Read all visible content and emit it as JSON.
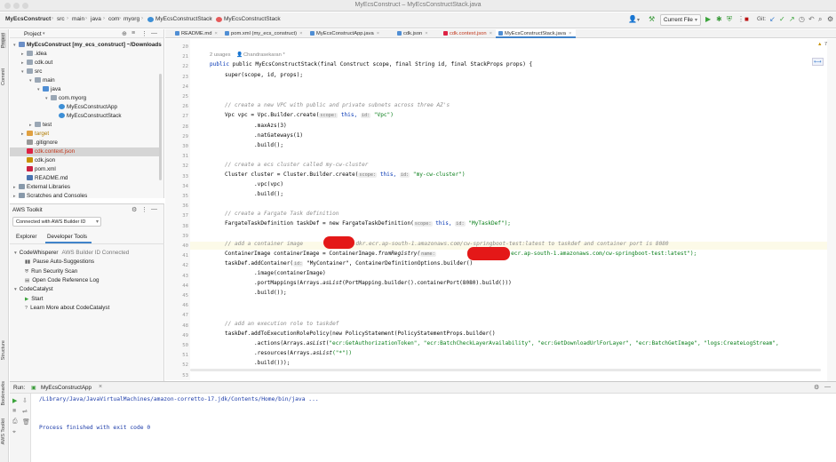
{
  "window": {
    "title": "MyEcsConstruct – MyEcsConstructStack.java"
  },
  "navbar": {
    "project": "MyEcsConstruct",
    "crumbs": [
      "src",
      "main",
      "java",
      "com",
      "myorg"
    ],
    "class_crumb": "MyEcsConstructStack",
    "class_crumb2": "MyEcsConstructStack",
    "run_config": "Current File"
  },
  "project_panel": {
    "title": "Project",
    "tree": [
      {
        "label": "MyEcsConstruct [my_ecs_construct] ~/Downloads",
        "indent": 0,
        "open": true,
        "kind": "module"
      },
      {
        "label": ".idea",
        "indent": 1,
        "open": false,
        "kind": "folder"
      },
      {
        "label": "cdk.out",
        "indent": 1,
        "open": false,
        "kind": "folder"
      },
      {
        "label": "src",
        "indent": 1,
        "open": true,
        "kind": "folder"
      },
      {
        "label": "main",
        "indent": 2,
        "open": true,
        "kind": "folder"
      },
      {
        "label": "java",
        "indent": 3,
        "open": true,
        "kind": "srcfolder"
      },
      {
        "label": "com.myorg",
        "indent": 4,
        "open": true,
        "kind": "package"
      },
      {
        "label": "MyEcsConstructApp",
        "indent": 5,
        "kind": "class"
      },
      {
        "label": "MyEcsConstructStack",
        "indent": 5,
        "kind": "class"
      },
      {
        "label": "test",
        "indent": 2,
        "open": false,
        "kind": "folder"
      },
      {
        "label": "target",
        "indent": 1,
        "open": false,
        "kind": "target"
      },
      {
        "label": ".gitignore",
        "indent": 1,
        "kind": "file"
      },
      {
        "label": "cdk.context.json",
        "indent": 1,
        "kind": "jsonred",
        "selected": true
      },
      {
        "label": "cdk.json",
        "indent": 1,
        "kind": "json"
      },
      {
        "label": "pom.xml",
        "indent": 1,
        "kind": "maven"
      },
      {
        "label": "README.md",
        "indent": 1,
        "kind": "md"
      },
      {
        "label": "External Libraries",
        "indent": 0,
        "open": false,
        "kind": "lib"
      },
      {
        "label": "Scratches and Consoles",
        "indent": 0,
        "open": false,
        "kind": "scratch"
      }
    ]
  },
  "aws_toolkit": {
    "title": "AWS Toolkit",
    "connection": "Connected with AWS Builder ID",
    "tabs": [
      "Explorer",
      "Developer Tools"
    ],
    "tree": [
      {
        "label": "CodeWhisperer",
        "suffix": "AWS Builder ID Connected",
        "indent": 0,
        "icon": "chevron"
      },
      {
        "label": "Pause Auto-Suggestions",
        "indent": 1,
        "icon": "pause"
      },
      {
        "label": "Run Security Scan",
        "indent": 1,
        "icon": "scan"
      },
      {
        "label": "Open Code Reference Log",
        "indent": 1,
        "icon": "doc"
      },
      {
        "label": "CodeCatalyst",
        "indent": 0,
        "icon": "chevron"
      },
      {
        "label": "Start",
        "indent": 1,
        "icon": "play"
      },
      {
        "label": "Learn More about CodeCatalyst",
        "indent": 1,
        "icon": "help"
      }
    ]
  },
  "editor": {
    "tabs": [
      {
        "label": "README.md",
        "active": false
      },
      {
        "label": "pom.xml (my_ecs_construct)",
        "active": false
      },
      {
        "label": "MyEcsConstructApp.java",
        "active": false
      },
      {
        "label": "cdk.json",
        "active": false
      },
      {
        "label": "cdk.context.json",
        "active": false,
        "red": true
      },
      {
        "label": "MyEcsConstructStack.java",
        "active": true
      }
    ],
    "usages": "2 usages",
    "author": "Chandrasekaran *",
    "line_numbers": [
      "20",
      "21",
      "22",
      "23",
      "24",
      "25",
      "26",
      "27",
      "28",
      "29",
      "30",
      "31",
      "32",
      "33",
      "34",
      "35",
      "36",
      "37",
      "38",
      "39",
      "40",
      "41",
      "42",
      "43",
      "44",
      "45",
      "46",
      "47",
      "48",
      "49",
      "50",
      "51",
      "52",
      "53",
      "54",
      "55",
      "56",
      "57",
      "58",
      "59",
      "60",
      "61",
      "62",
      "63"
    ],
    "code": {
      "sig": "public MyEcsConstructStack(final Construct scope, final String id, final StackProps props) {",
      "super": "super(scope, id, props);",
      "c1": "// create a new VPC with public and private subnets across three AZ's",
      "vpc1": "Vpc vpc = Vpc.Builder.create(",
      "vpc1_hint": "scope:",
      "vpc1_b": " this, ",
      "vpc1_hint2": "id:",
      "vpc1_c": " \"Vpc\")",
      "vpc2": ".maxAzs(3)",
      "vpc3": ".natGateways(1)",
      "vpc4": ".build();",
      "c2": "// create a ecs cluster called my-cw-cluster",
      "cl1": "Cluster cluster = Cluster.Builder.create(",
      "cl1_hint": "scope:",
      "cl1_b": " this, ",
      "cl1_hint2": "id:",
      "cl1_c": " \"my-cw-cluster\")",
      "cl2": ".vpc(vpc)",
      "cl3": ".build();",
      "c3": "// create a Fargate Task definition",
      "td1": "FargateTaskDefinition taskDef = new FargateTaskDefinition(",
      "td1_hint": "scope:",
      "td1_b": " this, ",
      "td1_hint2": "id:",
      "td1_c": " \"MyTaskDef\");",
      "c4a": "// add a container image ",
      "c4b": ".dkr.ecr.ap-south-1.amazonaws.com/cw-springboot-test:latest to taskdef and container port is 8080",
      "ci1": "ContainerImage containerImage = ContainerImage.",
      "ci1_m": "fromRegistry(",
      "ci1_hint": "name:",
      "ci1_c": ".dkr.ecr.ap-south-1.amazonaws.com/cw-springboot-test:latest\");",
      "ac1": "taskDef.addContainer(",
      "ac1_hint": "id:",
      "ac1_b": " \"MyContainer\", ContainerDefinitionOptions.builder()",
      "ac2": ".image(containerImage)",
      "ac3": ".portMappings(Arrays.",
      "ac3_m": "asList",
      "ac3_b": "(PortMapping.builder().containerPort(8080).build()))",
      "ac4": ".build());",
      "c5": "// add an execution role to taskdef",
      "ex1": "taskDef.addToExecutionRolePolicy(new PolicyStatement(PolicyStatementProps.builder()",
      "ex2a": ".actions(Arrays.",
      "ex2m": "asList",
      "ex2b": "(",
      "ex2s": "\"ecr:GetAuthorizationToken\", \"ecr:BatchCheckLayerAvailability\", \"ecr:GetDownloadUrlForLayer\", \"ecr:BatchGetImage\", \"logs:CreateLogStream\",",
      "ex3a": ".resources(Arrays.",
      "ex3m": "asList",
      "ex3b": "(\"*\"))",
      "ex4": ".build()));"
    },
    "inspection_count": "7"
  },
  "run_panel": {
    "label": "Run:",
    "config_tab": "MyEcsConstructApp",
    "cmd": "/Library/Java/JavaVirtualMachines/amazon-corretto-17.jdk/Contents/Home/bin/java ...",
    "result": "Process finished with exit code 0"
  },
  "left_tools": [
    "Project",
    "Commit",
    "Structure",
    "Bookmarks",
    "AWS Toolkit"
  ],
  "colors": {
    "accent": "#4083c9",
    "redaction": "#e41818",
    "comment": "#8c8c8c",
    "keyword": "#0033b3",
    "string": "#067d17"
  }
}
